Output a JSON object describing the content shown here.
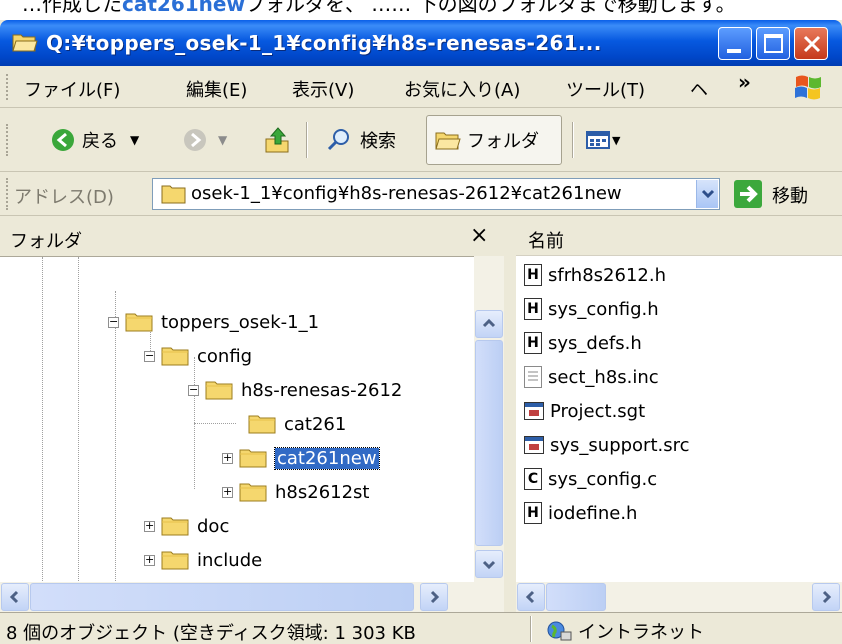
{
  "doc_strip": {
    "prefix": "…作成した",
    "highlight": "cat261new",
    "suffix": "フォルダを、 …… 下の図のフォルダまで移動します。"
  },
  "window": {
    "title": "Q:¥toppers_osek-1_1¥config¥h8s-renesas-261..."
  },
  "menu": {
    "items": [
      "ファイル(F)",
      "編集(E)",
      "表示(V)",
      "お気に入り(A)",
      "ツール(T)",
      "ヘ"
    ],
    "more": "»"
  },
  "toolbar": {
    "back": "戻る",
    "search": "検索",
    "folders": "フォルダ"
  },
  "address": {
    "label": "アドレス(D)",
    "value": "osek-1_1¥config¥h8s-renesas-2612¥cat261new",
    "go": "移動"
  },
  "folder_pane": {
    "title": "フォルダ",
    "close": "×",
    "tree": [
      {
        "label": "toppers_osek-1_1",
        "expander": "−",
        "selected": false
      },
      {
        "label": "config",
        "expander": "−",
        "selected": false
      },
      {
        "label": "h8s-renesas-2612",
        "expander": "−",
        "selected": false
      },
      {
        "label": "cat261",
        "expander": "",
        "selected": false
      },
      {
        "label": "cat261new",
        "expander": "+",
        "selected": true
      },
      {
        "label": "h8s2612st",
        "expander": "+",
        "selected": false
      },
      {
        "label": "doc",
        "expander": "+",
        "selected": false
      },
      {
        "label": "include",
        "expander": "+",
        "selected": false
      }
    ]
  },
  "files": {
    "column": "名前",
    "items": [
      {
        "name": "sfrh8s2612.h",
        "icon": "H"
      },
      {
        "name": "sys_config.h",
        "icon": "H"
      },
      {
        "name": "sys_defs.h",
        "icon": "H"
      },
      {
        "name": "sect_h8s.inc",
        "icon": "text"
      },
      {
        "name": "Project.sgt",
        "icon": "app"
      },
      {
        "name": "sys_support.src",
        "icon": "app"
      },
      {
        "name": "sys_config.c",
        "icon": "C"
      },
      {
        "name": "iodefine.h",
        "icon": "H"
      }
    ]
  },
  "status": {
    "objects": "8 個のオブジェクト (空きディスク領域: 1 303 KB",
    "zone": "イントラネット"
  }
}
